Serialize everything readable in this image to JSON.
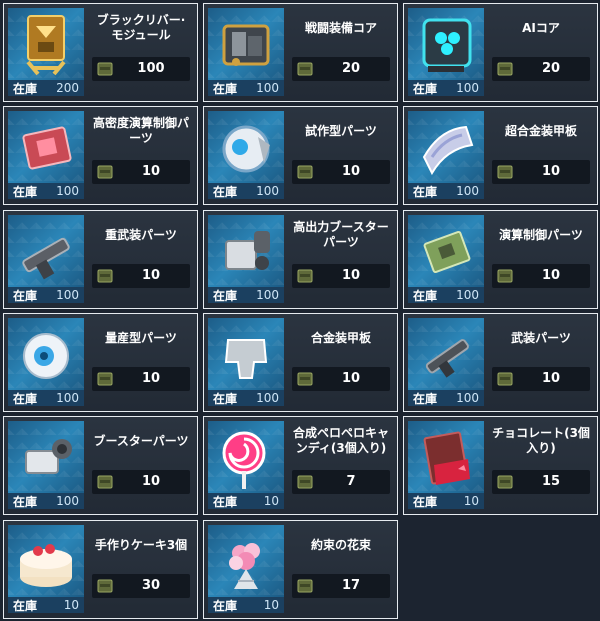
{
  "stock_label": "在庫",
  "cost_icon": "ammo-crate-icon",
  "items": [
    {
      "name": "ブラックリバー·\nモジュール",
      "stock": "200",
      "cost": "100",
      "icon": "black-river-module-icon"
    },
    {
      "name": "戦闘装備コア",
      "stock": "100",
      "cost": "20",
      "icon": "combat-gear-core-icon"
    },
    {
      "name": "AIコア",
      "stock": "100",
      "cost": "20",
      "icon": "ai-core-icon"
    },
    {
      "name": "高密度演算制御パ\nーツ",
      "stock": "100",
      "cost": "10",
      "icon": "computation-chip-icon"
    },
    {
      "name": "試作型パーツ",
      "stock": "100",
      "cost": "10",
      "icon": "prototype-parts-icon"
    },
    {
      "name": "超合金装甲板",
      "stock": "100",
      "cost": "10",
      "icon": "super-alloy-plate-icon"
    },
    {
      "name": "重武装パーツ",
      "stock": "100",
      "cost": "10",
      "icon": "heavy-weapon-parts-icon"
    },
    {
      "name": "高出力ブースター\nパーツ",
      "stock": "100",
      "cost": "10",
      "icon": "high-output-booster-icon"
    },
    {
      "name": "演算制御パーツ",
      "stock": "100",
      "cost": "10",
      "icon": "control-board-icon"
    },
    {
      "name": "量産型パーツ",
      "stock": "100",
      "cost": "10",
      "icon": "mass-production-parts-icon"
    },
    {
      "name": "合金装甲板",
      "stock": "100",
      "cost": "10",
      "icon": "alloy-plate-icon"
    },
    {
      "name": "武装パーツ",
      "stock": "100",
      "cost": "10",
      "icon": "weapon-parts-icon"
    },
    {
      "name": "ブースターパーツ",
      "stock": "100",
      "cost": "10",
      "icon": "booster-parts-icon"
    },
    {
      "name": "合成ペロペロキャ\nンディ(3個入り)",
      "stock": "10",
      "cost": "7",
      "icon": "lollipop-icon"
    },
    {
      "name": "チョコレート(3個\n入り)",
      "stock": "10",
      "cost": "15",
      "icon": "chocolate-icon"
    },
    {
      "name": "手作りケーキ3個",
      "stock": "10",
      "cost": "30",
      "icon": "cake-icon"
    },
    {
      "name": "約束の花束",
      "stock": "10",
      "cost": "17",
      "icon": "bouquet-icon"
    }
  ]
}
